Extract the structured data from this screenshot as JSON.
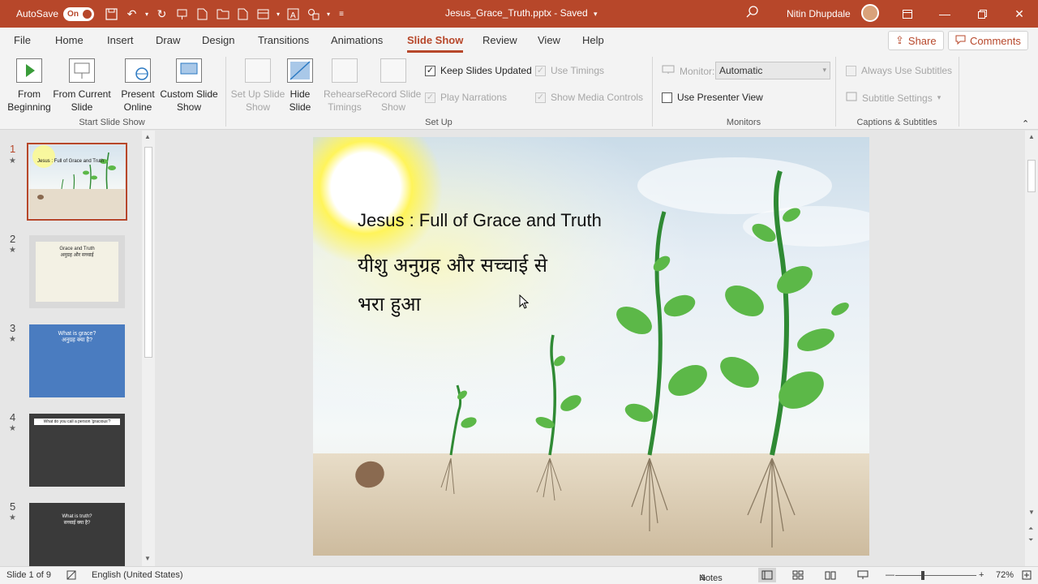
{
  "titlebar": {
    "autosave_label": "AutoSave",
    "autosave_state": "On",
    "doc_title": "Jesus_Grace_Truth.pptx - Saved",
    "user_name": "Nitin Dhupdale"
  },
  "tabs": [
    {
      "label": "File"
    },
    {
      "label": "Home"
    },
    {
      "label": "Insert"
    },
    {
      "label": "Draw"
    },
    {
      "label": "Design"
    },
    {
      "label": "Transitions"
    },
    {
      "label": "Animations"
    },
    {
      "label": "Slide Show"
    },
    {
      "label": "Review"
    },
    {
      "label": "View"
    },
    {
      "label": "Help"
    }
  ],
  "share_label": "Share",
  "comments_label": "Comments",
  "ribbon": {
    "start": {
      "from_beginning": "From Beginning",
      "from_current": "From Current Slide",
      "present_online": "Present Online",
      "custom_show": "Custom Slide Show",
      "group_label": "Start Slide Show"
    },
    "setup": {
      "setup_show": "Set Up Slide Show",
      "hide_slide": "Hide Slide",
      "rehearse": "Rehearse Timings",
      "record": "Record Slide Show",
      "keep_updated": "Keep Slides Updated",
      "play_narrations": "Play Narrations",
      "use_timings": "Use Timings",
      "show_media": "Show Media Controls",
      "group_label": "Set Up"
    },
    "monitors": {
      "monitor_label": "Monitor:",
      "monitor_value": "Automatic",
      "presenter_view": "Use Presenter View",
      "group_label": "Monitors"
    },
    "captions": {
      "always_subtitles": "Always Use Subtitles",
      "subtitle_settings": "Subtitle Settings",
      "group_label": "Captions & Subtitles"
    }
  },
  "thumbnails": {
    "t1_title": "Jesus : Full of Grace and Truth",
    "t2_title": "Grace and Truth",
    "t2_sub": "अनुग्रह और सच्चाई",
    "t3_title": "What is grace?",
    "t3_sub": "अनुग्रह क्या है?",
    "t4_title": "What do you call a person 'gracious'?",
    "t5_title": "What is truth?",
    "t5_sub": "सच्चाई क्या है?"
  },
  "slide": {
    "title": "Jesus : Full of Grace and Truth",
    "hindi_line1": "यीशु अनुग्रह और सच्चाई से",
    "hindi_line2": "भरा हुआ"
  },
  "status": {
    "slide_info": "Slide 1 of 9",
    "language": "English (United States)",
    "notes": "Notes",
    "zoom": "72%"
  },
  "colors": {
    "accent": "#b7472a",
    "sun": "#fff45a",
    "leaf": "#5cb848",
    "stem": "#2f8a34",
    "soil": "#d8ccb8"
  }
}
